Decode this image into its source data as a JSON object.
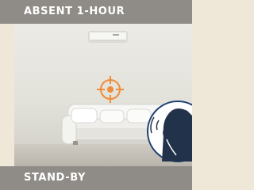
{
  "panel": {
    "top_label": "ABSENT 1-HOUR",
    "bottom_label": "STAND-BY"
  },
  "icons": {
    "target": "crosshair-target-icon",
    "person": "person-whispering-icon"
  },
  "colors": {
    "band": "#8f8c87",
    "background": "#efe7d8",
    "target": "#f08c3a",
    "person_ring": "#1f3f73"
  }
}
